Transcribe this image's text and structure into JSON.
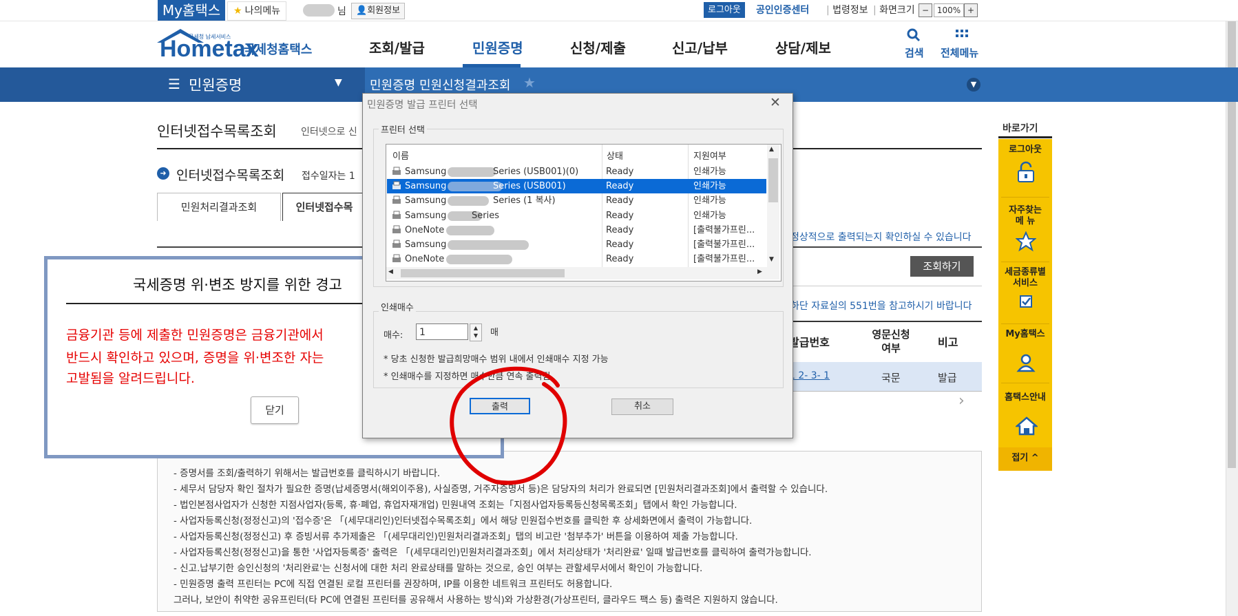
{
  "topbar": {
    "brand": "My홈택스",
    "my_menu": "나의메뉴",
    "sir": "님",
    "member_info": "회원정보",
    "logout": "로그아웃",
    "cert_center": "공인인증센터",
    "law_info": "법령정보",
    "screen_size": "화면크기",
    "zoom_minus": "−",
    "zoom": "100%",
    "zoom_plus": "+",
    "sep": "|"
  },
  "header": {
    "logo_text": "Hometax",
    "logo_sub": "국세청 납세서비스",
    "logo_kr": "국세청홈택스",
    "menu": [
      "조회/발급",
      "민원증명",
      "신청/제출",
      "신고/납부",
      "상담/제보"
    ],
    "search": "검색",
    "all_menu": "전체메뉴"
  },
  "nav": {
    "section": "민원증명",
    "crumb": "민원증명 민원신청결과조회"
  },
  "page": {
    "title": "인터넷접수목록조회",
    "title_desc": "인터넷으로 신",
    "section_title": "인터넷접수목록조회",
    "section_desc": "접수일자는 1",
    "tabs": [
      "민원처리결과조회",
      "인터넷접수목"
    ],
    "info1": "정상적으로 출력되는지 확인하실 수 있습니다",
    "search_button": "조회하기",
    "info2": "하단 자료실의 551번을 참고하시기 바랍니다",
    "table": {
      "headers": [
        "발급번호",
        "영문신청여부",
        "비고"
      ],
      "eng_header_lines": [
        "영문신청",
        "여부"
      ],
      "row": {
        "issue_no": "1 2-  3-  1",
        "eng": "국문",
        "note": "발급"
      }
    },
    "notes": [
      "- 증명서를 조회/출력하기 위해서는 발급번호를 클릭하시기 바랍니다.",
      "- 세무서 담당자 확인 절차가 필요한 증명(납세증명서(해외이주용), 사실증명, 거주자증명서 등)은 담당자의 처리가 완료되면 [민원처리결과조회]에서 출력할 수 있습니다.",
      "- 법인본점사업자가 신청한 지점사업자(등록, 휴·폐업, 휴업자재개업) 민원내역 조회는「지점사업자등록등신청목록조회」탭에서 확인 가능합니다.",
      "- 사업자등록신청(정정신고)의 '접수증'은 「(세무대리인)인터넷접수목록조회」에서 해당 민원접수번호를 클릭한 후 상세화면에서 출력이 가능합니다.",
      "- 사업자등록신청(정정신고) 후 증빙서류 추가제출은 「(세무대리인)민원처리결과조회」탭의 비고란 '첨부추가' 버튼을 이용하여 제출 가능합니다.",
      "- 사업자등록신청(정정신고)을 통한 '사업자등록증' 출력은 「(세무대리인)민원처리결과조회」에서 처리상태가 '처리완료' 일때 발급번호를 클릭하여 출력가능합니다.",
      "- 신고.납부기한 승인신청의 '처리완료'는 신청서에 대한 처리 완료상태를 말하는 것으로, 승인 여부는 관할세무서에서 확인이 가능합니다.",
      "- 민원증명 출력 프린터는 PC에 직접 연결된 로컬 프린터를 권장하며, IP를 이용한 네트워크 프린터도 허용합니다.",
      "  그러나, 보안이 취약한 공유프린터(타 PC에 연결된 프린터를 공유해서 사용하는 방식)와 가상환경(가상프린터, 클라우드 팩스 등) 출력은 지원하지 않습니다."
    ]
  },
  "quick": {
    "title": "바로가기",
    "items": [
      {
        "label": "로그아웃",
        "icon": "unlock-icon"
      },
      {
        "label": "자주찾는 메뉴",
        "icon": "star-icon"
      },
      {
        "label": "세금종류별 서비스",
        "icon": "checkbox-icon"
      },
      {
        "label": "My홈택스",
        "icon": "user-icon"
      },
      {
        "label": "홈택스안내",
        "icon": "house-icon"
      }
    ],
    "item_lines": [
      [
        "로그아웃"
      ],
      [
        "자주찾는",
        "메 뉴"
      ],
      [
        "세금종류별",
        "서비스"
      ],
      [
        "My홈택스"
      ],
      [
        "홈택스안내"
      ]
    ],
    "fold": "접기 ^"
  },
  "warning": {
    "title": "국세증명 위·변조 방지를 위한 경고",
    "lines": [
      "금융기관 등에 제출한 민원증명은 금융기관에서",
      "반드시 확인하고 있으며, 증명을 위·변조한 자는",
      "고발됨을 알려드립니다."
    ],
    "close": "닫기"
  },
  "printer_dialog": {
    "title": "민원증명 발급 프린터 선택",
    "group_printer": "프린터 선택",
    "columns": [
      "이름",
      "상태",
      "지원여부"
    ],
    "rows": [
      {
        "name": "Samsung",
        "model": "Series (USB001)(0)",
        "status": "Ready",
        "support": "인쇄가능",
        "selected": false
      },
      {
        "name": "Samsung",
        "model": "Series (USB001)",
        "status": "Ready",
        "support": "인쇄가능",
        "selected": true
      },
      {
        "name": "Samsung",
        "model": "Series (1 복사)",
        "status": "Ready",
        "support": "인쇄가능",
        "selected": false
      },
      {
        "name": "Samsung",
        "model": "Series",
        "status": "Ready",
        "support": "인쇄가능",
        "selected": false
      },
      {
        "name": "OneNote",
        "model": "",
        "status": "Ready",
        "support": "[출력불가프린...",
        "selected": false
      },
      {
        "name": "Samsung",
        "model": "",
        "status": "Ready",
        "support": "[출력불가프린...",
        "selected": false
      },
      {
        "name": "OneNote",
        "model": "",
        "status": "Ready",
        "support": "[출력불가프린...",
        "selected": false
      }
    ],
    "group_copies": "인쇄매수",
    "copies_label": "매수:",
    "copies_value": "1",
    "copies_unit": "매",
    "hint1": "* 당초 신청한 발급희망매수 범위 내에서 인쇄매수 지정 가능",
    "hint2": "* 인쇄매수를 지정하면 매수만큼 연속 출력됨",
    "print": "출력",
    "cancel": "취소"
  },
  "colors": {
    "brand_blue": "#1f5fa9",
    "nav_blue": "#2e6db4",
    "quick_yellow": "#f6c400",
    "warning_red": "#e60000",
    "selection_blue": "#0a6ad6",
    "annotation_red": "#e00000"
  }
}
